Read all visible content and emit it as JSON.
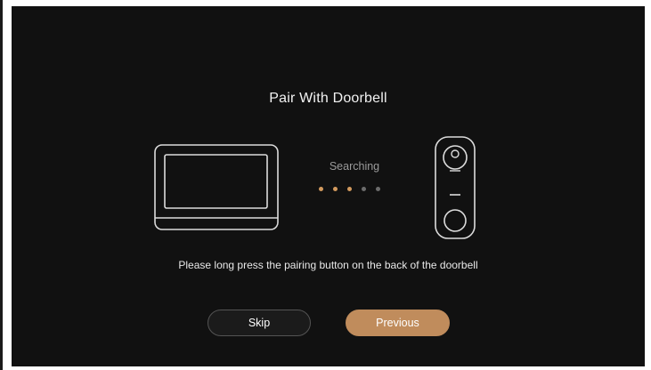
{
  "page": {
    "title": "Pair With Doorbell",
    "status_text": "Searching",
    "progress": {
      "total_dots": 5,
      "active_dots": 3
    },
    "instruction": "Please long press the pairing button on the back of the doorbell"
  },
  "buttons": {
    "skip_label": "Skip",
    "previous_label": "Previous"
  },
  "icons": {
    "monitor": "indoor-monitor-icon",
    "doorbell": "video-doorbell-icon"
  },
  "colors": {
    "background": "#111111",
    "accent": "#c08c5c",
    "dot_active": "#d39a5e",
    "dot_inactive": "#6c6c6c"
  }
}
